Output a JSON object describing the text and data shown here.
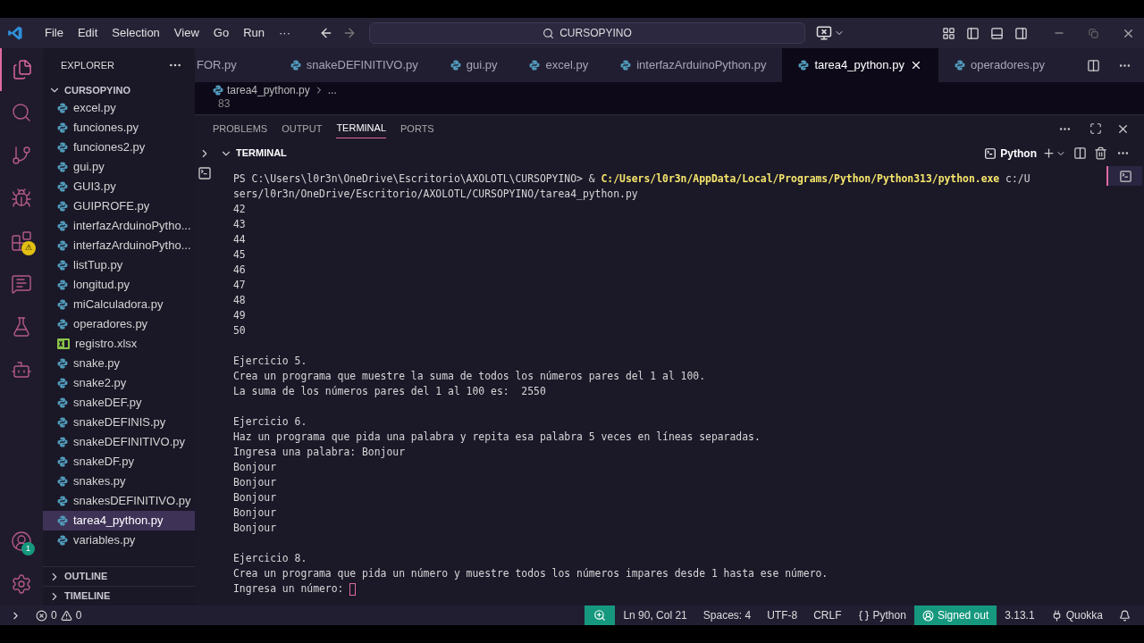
{
  "menu": [
    "File",
    "Edit",
    "Selection",
    "View",
    "Go",
    "Run",
    "···"
  ],
  "search": {
    "value": "CURSOPYINO"
  },
  "activity": [
    {
      "kind": "files",
      "selected": true
    },
    {
      "kind": "search",
      "selected": false
    },
    {
      "kind": "git",
      "selected": false
    },
    {
      "kind": "debug",
      "selected": false
    },
    {
      "kind": "extensions",
      "selected": false,
      "badge": "⚠"
    },
    {
      "kind": "chat",
      "selected": false
    },
    {
      "kind": "flask",
      "selected": false
    },
    {
      "kind": "robot",
      "selected": false
    }
  ],
  "activity_bottom": [
    {
      "kind": "account",
      "badge": "1"
    },
    {
      "kind": "settings"
    }
  ],
  "sidebar": {
    "title": "EXPLORER",
    "folder": "CURSOPYINO",
    "items": [
      {
        "name": "excel.py",
        "kind": "python",
        "selected": false
      },
      {
        "name": "funciones.py",
        "kind": "python",
        "selected": false
      },
      {
        "name": "funciones2.py",
        "kind": "python",
        "selected": false
      },
      {
        "name": "gui.py",
        "kind": "python",
        "selected": false
      },
      {
        "name": "GUI3.py",
        "kind": "python",
        "selected": false
      },
      {
        "name": "GUIPROFE.py",
        "kind": "python",
        "selected": false
      },
      {
        "name": "interfazArduinoPytho...",
        "kind": "python",
        "selected": false
      },
      {
        "name": "interfazArduinoPytho...",
        "kind": "python",
        "selected": false
      },
      {
        "name": "listTup.py",
        "kind": "python",
        "selected": false
      },
      {
        "name": "longitud.py",
        "kind": "python",
        "selected": false
      },
      {
        "name": "miCalculadora.py",
        "kind": "python",
        "selected": false
      },
      {
        "name": "operadores.py",
        "kind": "python",
        "selected": false
      },
      {
        "name": "registro.xlsx",
        "kind": "excel",
        "selected": false
      },
      {
        "name": "snake.py",
        "kind": "python",
        "selected": false
      },
      {
        "name": "snake2.py",
        "kind": "python",
        "selected": false
      },
      {
        "name": "snakeDEF.py",
        "kind": "python",
        "selected": false
      },
      {
        "name": "snakeDEFINIS.py",
        "kind": "python",
        "selected": false
      },
      {
        "name": "snakeDEFINITIVO.py",
        "kind": "python",
        "selected": false
      },
      {
        "name": "snakeDF.py",
        "kind": "python",
        "selected": false
      },
      {
        "name": "snakes.py",
        "kind": "python",
        "selected": false
      },
      {
        "name": "snakesDEFINITIVO.py",
        "kind": "python",
        "selected": false
      },
      {
        "name": "tarea4_python.py",
        "kind": "python",
        "selected": true
      },
      {
        "name": "variables.py",
        "kind": "python",
        "selected": false
      }
    ],
    "sections": [
      "OUTLINE",
      "TIMELINE"
    ]
  },
  "tabs": [
    {
      "label": "FOR.py",
      "selected": false
    },
    {
      "label": "snakeDEFINITIVO.py",
      "selected": false
    },
    {
      "label": "gui.py",
      "selected": false
    },
    {
      "label": "excel.py",
      "selected": false
    },
    {
      "label": "interfazArduinoPython.py",
      "selected": false
    },
    {
      "label": "tarea4_python.py",
      "selected": true
    },
    {
      "label": "operadores.py",
      "selected": false
    }
  ],
  "breadcrumb": {
    "file": "tarea4_python.py",
    "rest": "..."
  },
  "editor": {
    "line_number": "83"
  },
  "panel": {
    "tabs": [
      {
        "label": "PROBLEMS",
        "selected": false
      },
      {
        "label": "OUTPUT",
        "selected": false
      },
      {
        "label": "TERMINAL",
        "selected": true
      },
      {
        "label": "PORTS",
        "selected": false
      }
    ],
    "section": "TERMINAL",
    "shell": "Python",
    "lines": [
      {
        "kind": "command",
        "prompt": "PS C:\\Users\\l0r3n\\OneDrive\\Escritorio\\AXOLOTL\\CURSOPYINO> & ",
        "executable": "C:/Users/l0r3n/AppData/Local/Programs/Python/Python313/python.exe",
        "argument": " c:/U"
      },
      {
        "kind": "text",
        "text": "sers/l0r3n/OneDrive/Escritorio/AXOLOTL/CURSOPYINO/tarea4_python.py"
      },
      {
        "kind": "text",
        "text": "42"
      },
      {
        "kind": "text",
        "text": "43"
      },
      {
        "kind": "text",
        "text": "44"
      },
      {
        "kind": "text",
        "text": "45"
      },
      {
        "kind": "text",
        "text": "46"
      },
      {
        "kind": "text",
        "text": "47"
      },
      {
        "kind": "text",
        "text": "48"
      },
      {
        "kind": "text",
        "text": "49"
      },
      {
        "kind": "text",
        "text": "50"
      },
      {
        "kind": "blank"
      },
      {
        "kind": "text",
        "text": "Ejercicio 5."
      },
      {
        "kind": "text",
        "text": "Crea un programa que muestre la suma de todos los números pares del 1 al 100."
      },
      {
        "kind": "text",
        "text": "La suma de los números pares del 1 al 100 es:  2550"
      },
      {
        "kind": "blank"
      },
      {
        "kind": "text",
        "text": "Ejercicio 6."
      },
      {
        "kind": "text",
        "text": "Haz un programa que pida una palabra y repita esa palabra 5 veces en líneas separadas."
      },
      {
        "kind": "text",
        "text": "Ingresa una palabra: Bonjour"
      },
      {
        "kind": "text",
        "text": "Bonjour"
      },
      {
        "kind": "text",
        "text": "Bonjour"
      },
      {
        "kind": "text",
        "text": "Bonjour"
      },
      {
        "kind": "text",
        "text": "Bonjour"
      },
      {
        "kind": "text",
        "text": "Bonjour"
      },
      {
        "kind": "blank"
      },
      {
        "kind": "text",
        "text": "Ejercicio 8."
      },
      {
        "kind": "text",
        "text": "Crea un programa que pida un número y muestre todos los números impares desde 1 hasta ese número."
      },
      {
        "kind": "input",
        "text": "Ingresa un número: "
      }
    ]
  },
  "status": {
    "errors": "0",
    "warnings": "0",
    "items": [
      {
        "kind": "zoom",
        "accent": true
      },
      {
        "kind": "text",
        "text": "Ln 90, Col 21",
        "accent": false
      },
      {
        "kind": "text",
        "text": "Spaces: 4",
        "accent": false
      },
      {
        "kind": "text",
        "text": "UTF-8",
        "accent": false
      },
      {
        "kind": "text",
        "text": "CRLF",
        "accent": false
      },
      {
        "kind": "language",
        "text": "Python",
        "accent": false
      },
      {
        "kind": "account",
        "text": "Signed out",
        "accent": true
      },
      {
        "kind": "text",
        "text": "3.13.1",
        "accent": false
      },
      {
        "kind": "quokka",
        "text": "Quokka",
        "accent": false
      },
      {
        "kind": "bell",
        "accent": false
      }
    ]
  }
}
